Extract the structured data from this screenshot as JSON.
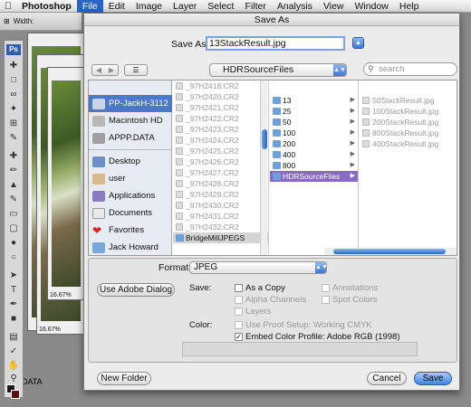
{
  "menubar": {
    "app": "Photoshop",
    "items": [
      "File",
      "Edit",
      "Image",
      "Layer",
      "Select",
      "Filter",
      "Analysis",
      "View",
      "Window",
      "Help"
    ],
    "active": "File"
  },
  "options_bar": {
    "width_label": "Width:"
  },
  "tools": {
    "logo": "Ps"
  },
  "background_docs": {
    "zoom1": "16.67%",
    "zoom2": "16.67%",
    "label": "DATA"
  },
  "dialog": {
    "title": "Save As",
    "save_as_label": "Save As:",
    "filename": "13StackResult.jpg",
    "folder": "HDRSourceFiles",
    "search_placeholder": "search",
    "sidebar": [
      {
        "label": "PP-JackH-3112",
        "icon": "computer-icon",
        "selected": true
      },
      {
        "label": "Macintosh HD",
        "icon": "harddisk-icon"
      },
      {
        "label": "APPP.DATA",
        "icon": "harddisk-icon"
      },
      {
        "label": "Desktop",
        "icon": "desktop-icon"
      },
      {
        "label": "user",
        "icon": "home-icon"
      },
      {
        "label": "Applications",
        "icon": "applications-icon"
      },
      {
        "label": "Documents",
        "icon": "documents-icon"
      },
      {
        "label": "Favorites",
        "icon": "heart-icon"
      },
      {
        "label": "Jack Howard",
        "icon": "folder-icon"
      }
    ],
    "column1": [
      "_97H2418.CR2",
      "_97H2420.CR2",
      "_97H2421.CR2",
      "_97H2422.CR2",
      "_97H2423.CR2",
      "_97H2424.CR2",
      "_97H2425.CR2",
      "_97H2426.CR2",
      "_97H2427.CR2",
      "_97H2428.CR2",
      "_97H2429.CR2",
      "_97H2430.CR2",
      "_97H2431.CR2",
      "_97H2432.CR2"
    ],
    "column1_folder": "BridgeMillJPEGS",
    "column2": [
      "13",
      "25",
      "50",
      "100",
      "200",
      "400",
      "800",
      "HDRSourceFiles"
    ],
    "column3": [
      "50StackResult.jpg",
      "100StackResult.jpg",
      "200StackResult.jpg",
      "800StackResult.jpg",
      "400StackResult.jpg"
    ],
    "format_label": "Format:",
    "format_value": "JPEG",
    "use_adobe_dialog": "Use Adobe Dialog",
    "save_label": "Save:",
    "save_options": [
      {
        "label": "As a Copy",
        "enabled": true,
        "checked": false
      },
      {
        "label": "Annotations",
        "enabled": false,
        "checked": false
      },
      {
        "label": "Alpha Channels",
        "enabled": false,
        "checked": false
      },
      {
        "label": "Spot Colors",
        "enabled": false,
        "checked": false
      },
      {
        "label": "Layers",
        "enabled": false,
        "checked": false
      }
    ],
    "color_label": "Color:",
    "proof_setup": "Use Proof Setup:  Working CMYK",
    "embed_profile": "Embed Color Profile:  Adobe RGB (1998)",
    "new_folder": "New Folder",
    "cancel": "Cancel",
    "save": "Save"
  }
}
